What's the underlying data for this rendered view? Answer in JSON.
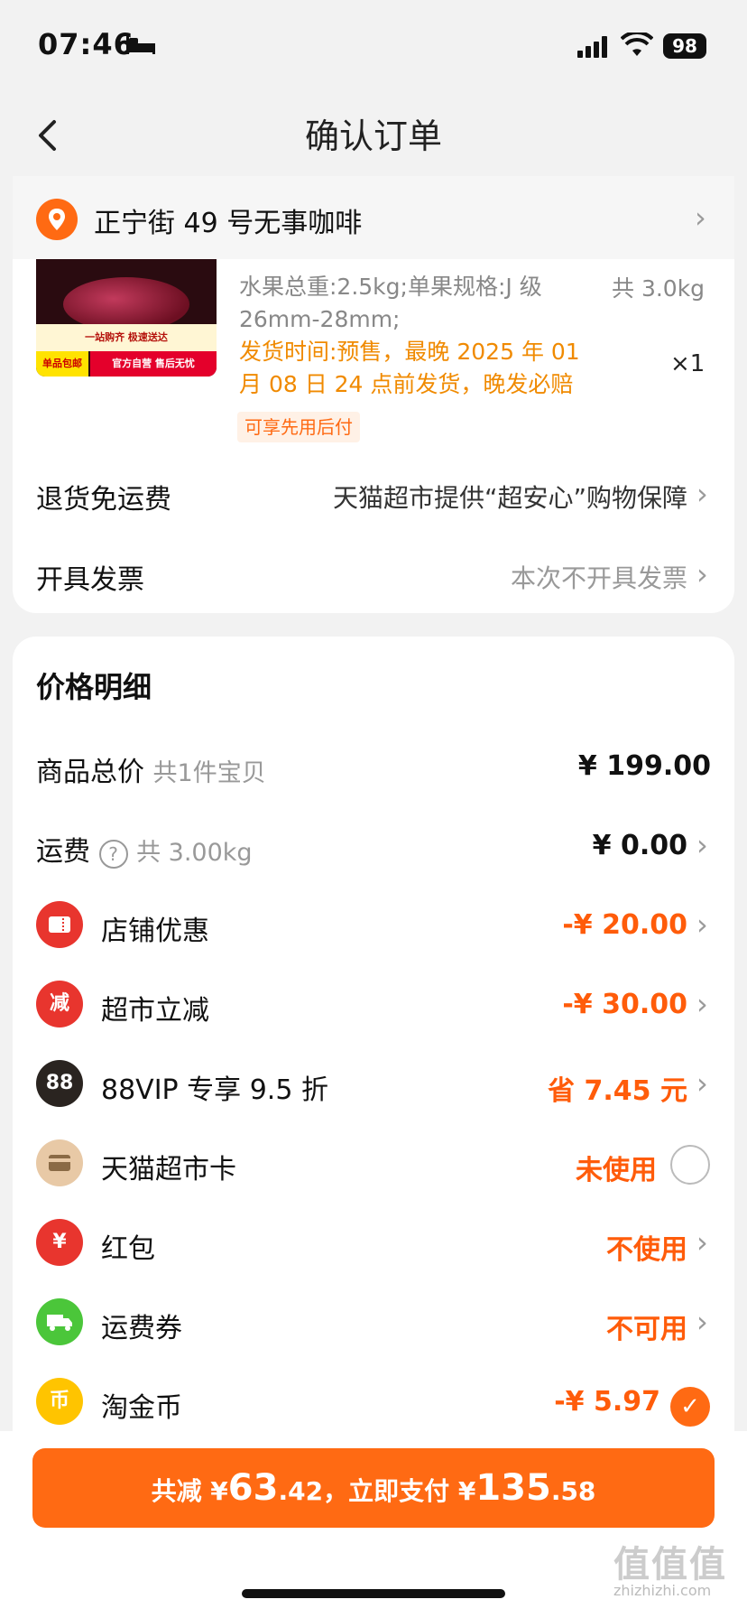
{
  "status_bar": {
    "time": "07:46",
    "battery": "98"
  },
  "nav": {
    "title": "确认订单"
  },
  "address": {
    "text": "正宁街 49 号无事咖啡"
  },
  "product": {
    "image_banner": "一站购齐 极速送达",
    "image_tag_left": "单品包邮",
    "image_tag_right": "官方自营 售后无忧",
    "spec": "水果总重:2.5kg;单果规格:J 级 26mm-28mm;",
    "total_weight": "共 3.0kg",
    "ship_time": "发货时间:预售，最晚 2025 年 01 月 08 日 24 点前发货，晚发必赔",
    "quantity": "×1",
    "badge": "可享先用后付"
  },
  "services": [
    {
      "label": "退货免运费",
      "value": "天猫超市提供“超安心”购物保障"
    },
    {
      "label": "开具发票",
      "value": "本次不开具发票"
    }
  ],
  "price": {
    "title": "价格明细",
    "goods_total_label": "商品总价",
    "goods_total_sub": "共1件宝贝",
    "goods_total_value": "¥ 199.00",
    "freight_label": "运费",
    "freight_sub": "共 3.00kg",
    "freight_value": "¥ 0.00",
    "items": [
      {
        "label": "店铺优惠",
        "value": "-¥ 20.00",
        "icon": "ticket-icon",
        "color": "#e8352e"
      },
      {
        "label": "超市立减",
        "value": "-¥ 30.00",
        "icon": "jian-icon",
        "color": "#e8352e",
        "glyph": "减"
      },
      {
        "label": "88VIP 专享 9.5 折",
        "value": "省 7.45 元",
        "icon": "vip88-icon",
        "color": "#2a2420",
        "glyph": "88"
      },
      {
        "label": "天猫超市卡",
        "value": "未使用",
        "icon": "card-icon",
        "color": "#e8c9a6"
      },
      {
        "label": "红包",
        "value": "不使用",
        "icon": "redpacket-icon",
        "color": "#e8352e",
        "glyph": "¥"
      },
      {
        "label": "运费券",
        "value": "不可用",
        "icon": "truck-icon",
        "color": "#4bc63a"
      },
      {
        "label": "淘金币",
        "value": "-¥ 5.97",
        "icon": "coin-icon",
        "color": "#ffc400",
        "glyph": "币"
      }
    ]
  },
  "pay": {
    "prefix": "共减 ¥",
    "reduce_int": "63",
    "reduce_dec": ".42",
    "mid": "，立即支付 ¥",
    "pay_int": "135",
    "pay_dec": ".58"
  },
  "watermark": {
    "logo": "值值值",
    "url": "zhizhizhi.com"
  }
}
